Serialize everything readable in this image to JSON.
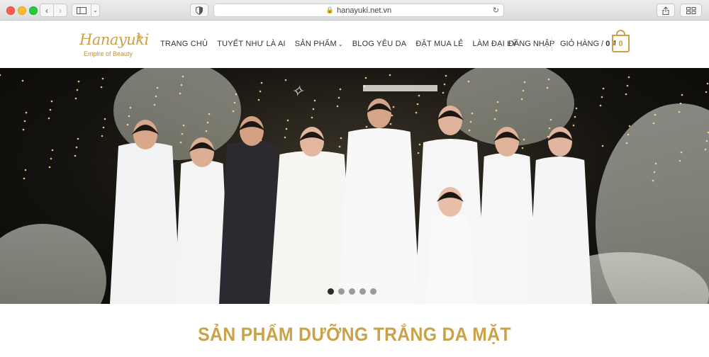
{
  "browser": {
    "url": "hanayuki.net.vn"
  },
  "logo": {
    "name": "Hanayuki",
    "tagline": "Empire of Beauty"
  },
  "nav": {
    "items": [
      {
        "label": "TRANG CHỦ"
      },
      {
        "label": "TUYẾT NHƯ LÀ AI"
      },
      {
        "label": "SẢN PHẨM"
      },
      {
        "label": "BLOG YÊU DA"
      },
      {
        "label": "ĐẶT MUA LẺ"
      },
      {
        "label": "LÀM ĐẠI LÝ"
      }
    ],
    "login": "ĐĂNG NHẬP",
    "cart_label": "GIỎ HÀNG /",
    "cart_total": "0 ₫",
    "cart_count": "0"
  },
  "hero": {
    "slides_count": 5,
    "active_slide": 1
  },
  "section": {
    "title": "SẢN PHẨM DƯỠNG TRẮNG DA MẶT"
  },
  "colors": {
    "brand_gold": "#c9a24a"
  }
}
